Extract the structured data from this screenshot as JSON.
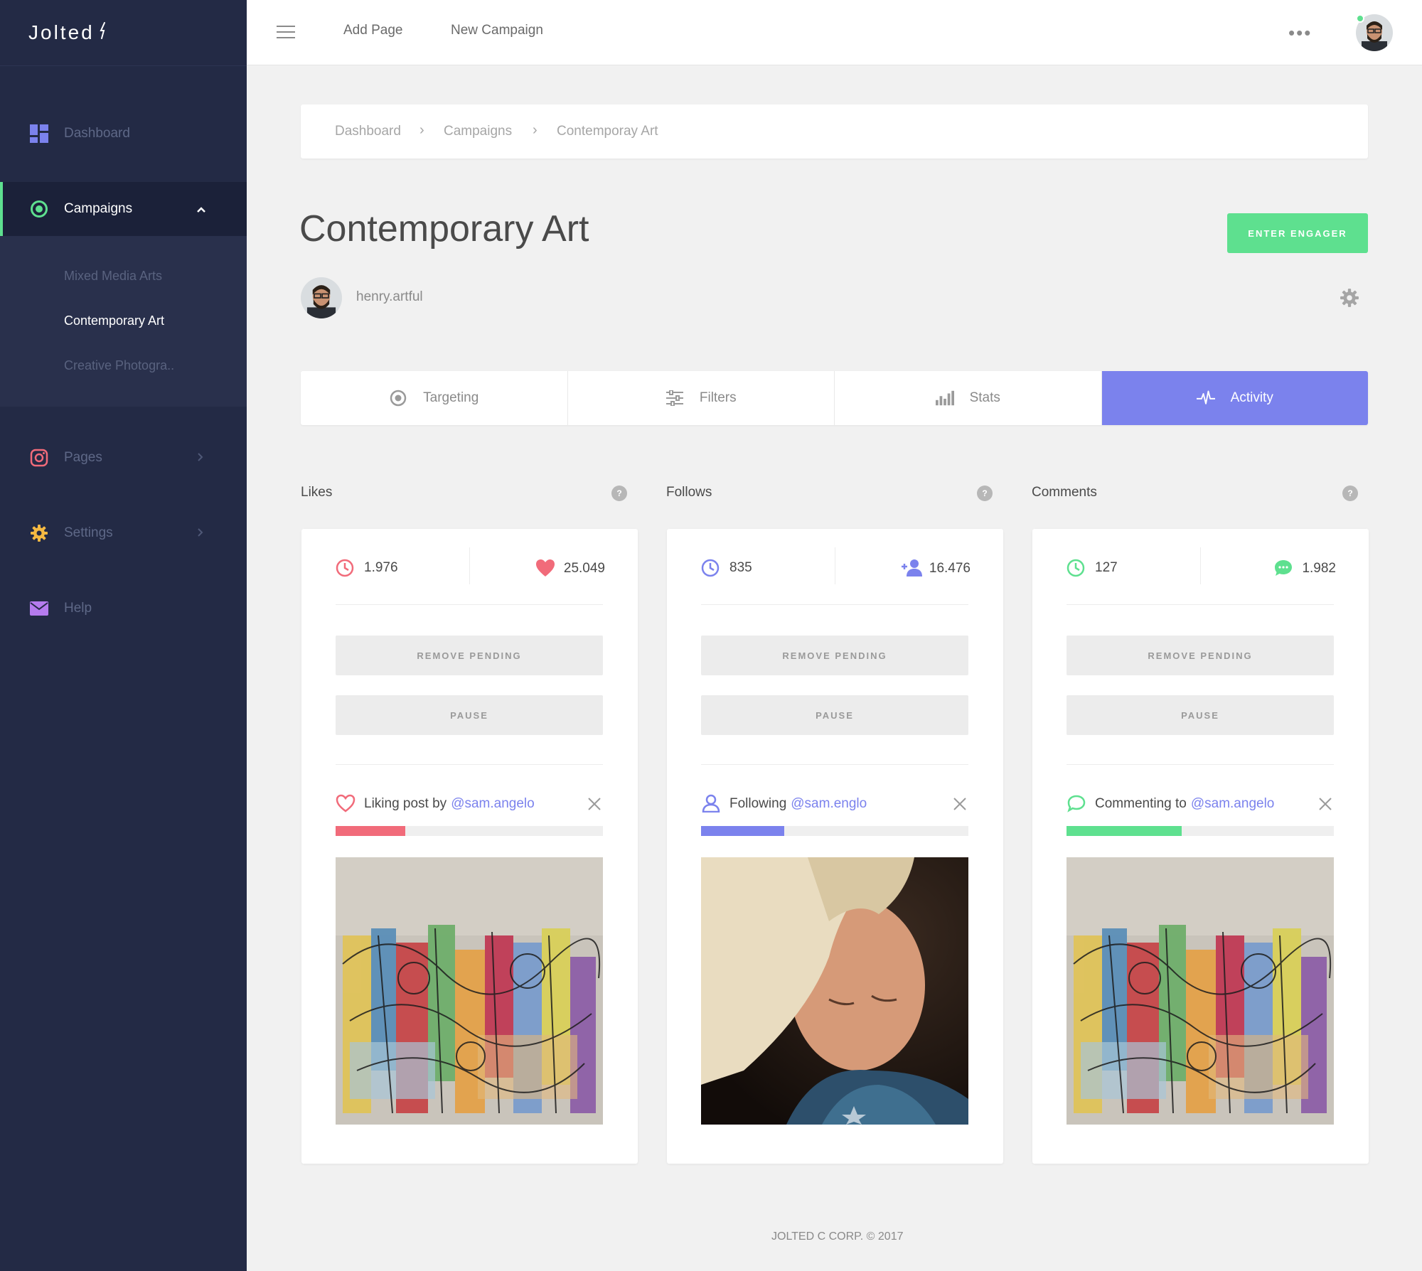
{
  "app": {
    "logo": "Jolted",
    "logo_mark": "⚡"
  },
  "sidebar": {
    "items": [
      {
        "label": "Dashboard"
      },
      {
        "label": "Campaigns"
      },
      {
        "label": "Pages"
      },
      {
        "label": "Settings"
      },
      {
        "label": "Help"
      }
    ],
    "sub_items": [
      {
        "label": "Mixed Media Arts"
      },
      {
        "label": "Contemporary Art"
      },
      {
        "label": "Creative Photogra.."
      }
    ]
  },
  "topbar": {
    "links": [
      "Add Page",
      "New Campaign"
    ],
    "more": "•••"
  },
  "breadcrumb": [
    "Dashboard",
    "Campaigns",
    "Contemporay Art"
  ],
  "breadcrumb_sep": "›",
  "page": {
    "title": "Contemporary Art",
    "engage_button": "ENTER ENGAGER",
    "username": "henry.artful"
  },
  "tabs": [
    {
      "label": "Targeting",
      "active": false
    },
    {
      "label": "Filters",
      "active": false
    },
    {
      "label": "Stats",
      "active": false
    },
    {
      "label": "Activity",
      "active": true
    }
  ],
  "help_glyph": "?",
  "colors": {
    "sidebar_bg": "#232a45",
    "accent_green": "#5ee08f",
    "accent_purple": "#7b82ed",
    "accent_red": "#f16b7a"
  },
  "columns": [
    {
      "title": "Likes",
      "stat_left": "1.976",
      "stat_right": "25.049",
      "remove_label": "REMOVE PENDING",
      "pause_label": "PAUSE",
      "activity_prefix": "Liking post by",
      "activity_handle": "@sam.angelo",
      "progress": 0.26,
      "color": "#f16b7a",
      "icon": "heart-icon"
    },
    {
      "title": "Follows",
      "stat_left": "835",
      "stat_right": "16.476",
      "remove_label": "REMOVE PENDING",
      "pause_label": "PAUSE",
      "activity_prefix": "Following",
      "activity_handle": "@sam.englo",
      "progress": 0.31,
      "color": "#7b82ed",
      "icon": "user-icon"
    },
    {
      "title": "Comments",
      "stat_left": "127",
      "stat_right": "1.982",
      "remove_label": "REMOVE PENDING",
      "pause_label": "PAUSE",
      "activity_prefix": "Commenting to",
      "activity_handle": "@sam.angelo",
      "progress": 0.43,
      "color": "#5ee08f",
      "icon": "comment-icon"
    }
  ],
  "footer": "JOLTED C CORP. © 2017"
}
